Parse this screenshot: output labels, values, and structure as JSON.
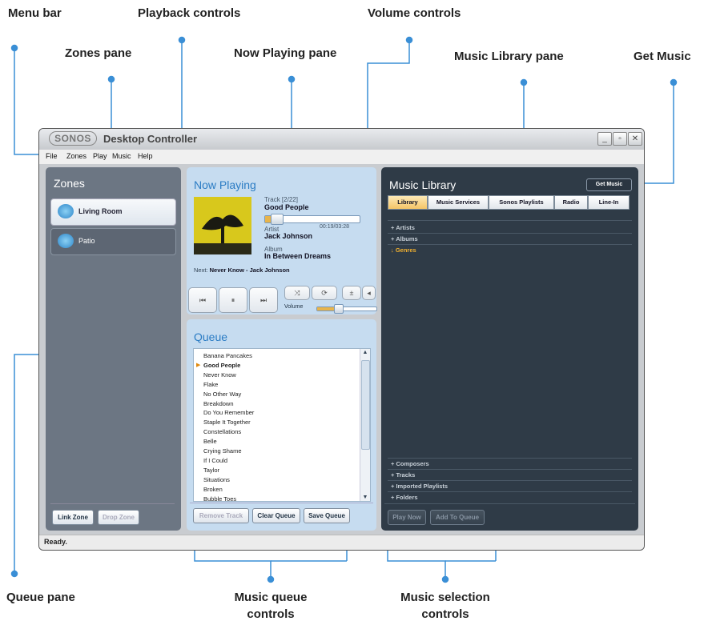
{
  "callouts": {
    "menu_bar": "Menu bar",
    "playback_controls": "Playback controls",
    "volume_controls": "Volume controls",
    "zones_pane": "Zones pane",
    "now_playing_pane": "Now Playing pane",
    "music_library_pane": "Music Library pane",
    "get_music": "Get Music",
    "queue_pane": "Queue pane",
    "music_queue_controls_line1": "Music queue",
    "music_queue_controls_line2": "controls",
    "music_selection_controls_line1": "Music selection",
    "music_selection_controls_line2": "controls"
  },
  "window": {
    "logo": "SONOS",
    "title": "Desktop Controller",
    "status": "Ready.",
    "menus": [
      "File",
      "Zones",
      "Play",
      "Music",
      "Help"
    ]
  },
  "zones": {
    "title": "Zones",
    "items": [
      {
        "label": "Living Room",
        "active": true
      },
      {
        "label": "Patio",
        "active": false
      }
    ],
    "link_zone": "Link Zone",
    "drop_zone": "Drop Zone"
  },
  "now_playing": {
    "title": "Now Playing",
    "track_label": "Track [2/22]",
    "track": "Good People",
    "time": "00:19/03:28",
    "progress_fraction": 0.09,
    "artist_label": "Artist",
    "artist": "Jack Johnson",
    "album_label": "Album",
    "album": "In Between Dreams",
    "next_label": "Next:",
    "next": "Never Know - Jack Johnson",
    "volume_label": "Volume",
    "volume_fraction": 0.35
  },
  "queue": {
    "title": "Queue",
    "current_index": 1,
    "tracks": [
      "Banana Pancakes",
      "Good People",
      "Never Know",
      "Flake",
      "No Other Way",
      "Breakdown",
      "Do You Remember",
      "Staple It Together",
      "Constellations",
      "Belle",
      "Crying Shame",
      "If I Could",
      "Taylor",
      "Situations",
      "Broken",
      "Bubble Toes"
    ],
    "remove_track": "Remove Track",
    "clear_queue": "Clear Queue",
    "save_queue": "Save Queue"
  },
  "music_library": {
    "title": "Music Library",
    "get_music": "Get Music",
    "tabs": [
      "Library",
      "Music Services",
      "Sonos Playlists",
      "Radio",
      "Line-In"
    ],
    "active_tab": 0,
    "categories_top": [
      "Artists",
      "Albums",
      "Genres"
    ],
    "categories_bottom": [
      "Composers",
      "Tracks",
      "Imported Playlists",
      "Folders"
    ],
    "play_now": "Play Now",
    "add_to_queue": "Add To Queue"
  },
  "colors": {
    "accent_blue": "#2b7cc4",
    "callout_line": "#3a8fd6",
    "zones_bg": "#6c7683",
    "library_bg": "#2f3b47",
    "nowplaying_bg": "#c6dcf0",
    "highlight_orange": "#f0b030"
  }
}
